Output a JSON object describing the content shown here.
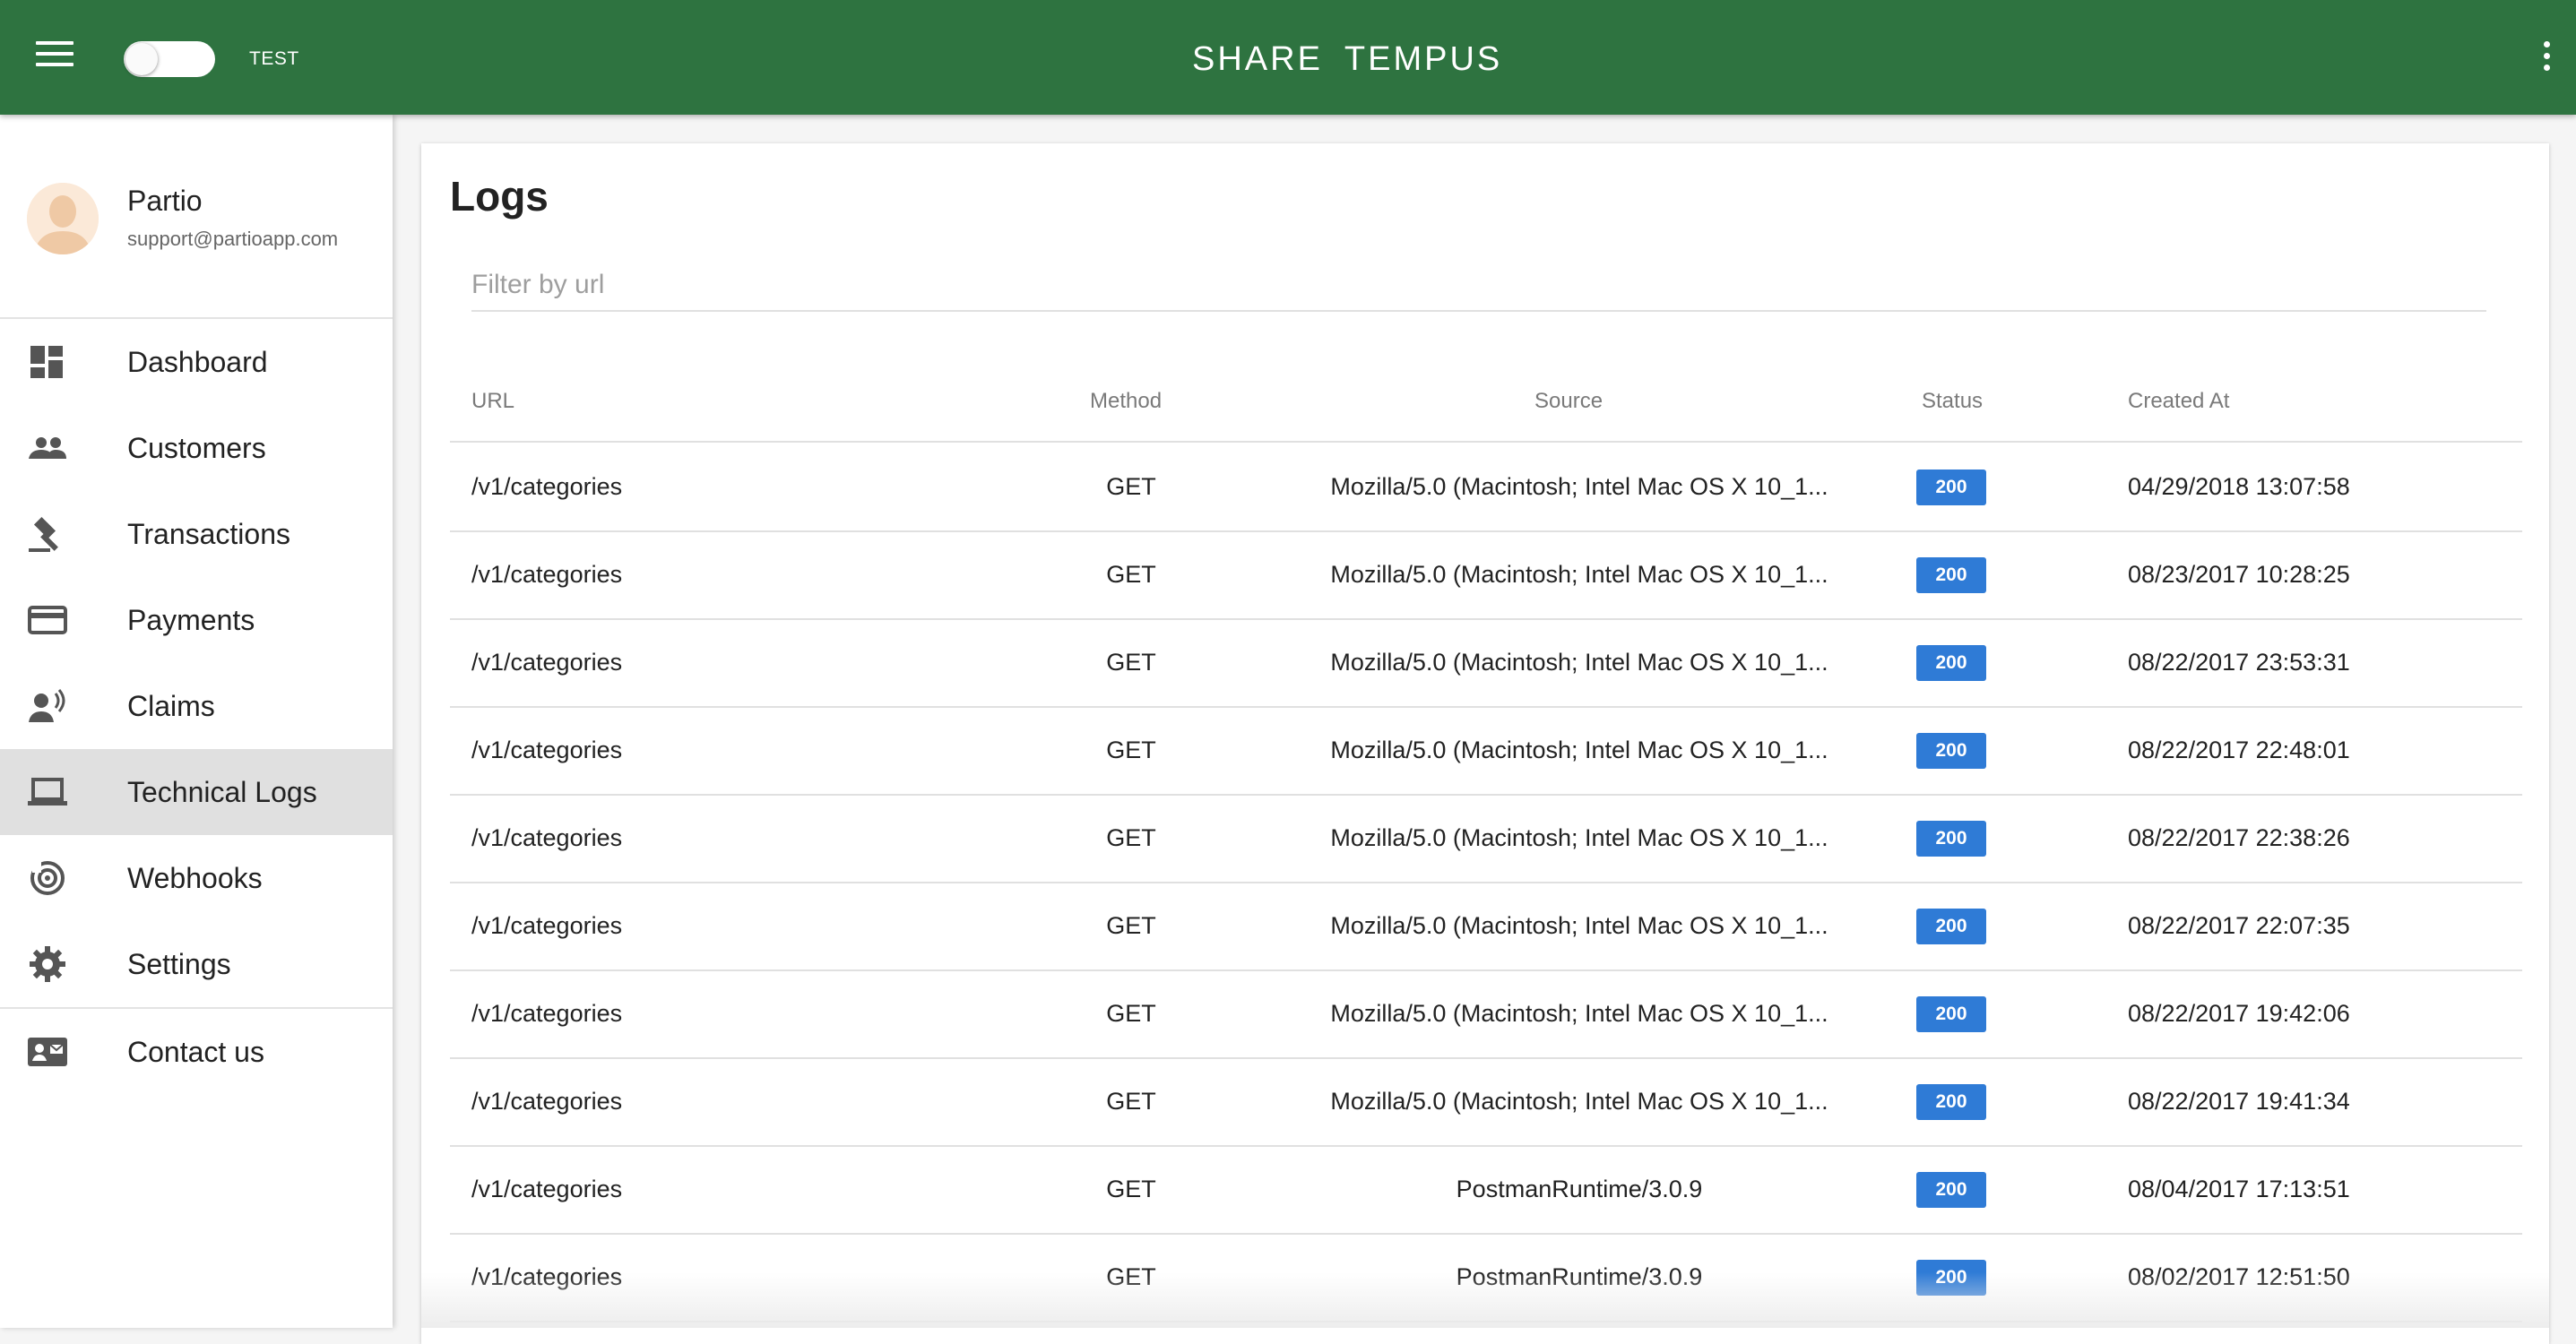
{
  "header": {
    "env_label": "TEST",
    "logo_left": "SHARE",
    "logo_right": "TEMPUS",
    "accent": "#2e7340"
  },
  "profile": {
    "name": "Partio",
    "email": "support@partioapp.com"
  },
  "sidebar": {
    "items": [
      {
        "label": "Dashboard",
        "icon": "dashboard-icon"
      },
      {
        "label": "Customers",
        "icon": "people-icon"
      },
      {
        "label": "Transactions",
        "icon": "gavel-icon"
      },
      {
        "label": "Payments",
        "icon": "credit-card-icon"
      },
      {
        "label": "Claims",
        "icon": "record-voice-icon"
      },
      {
        "label": "Technical Logs",
        "icon": "laptop-icon",
        "active": true
      },
      {
        "label": "Webhooks",
        "icon": "webhook-icon"
      },
      {
        "label": "Settings",
        "icon": "gear-icon"
      },
      {
        "label": "Contact us",
        "icon": "contact-mail-icon"
      }
    ]
  },
  "main": {
    "title": "Logs",
    "filter_placeholder": "Filter by url",
    "columns": {
      "url": "URL",
      "method": "Method",
      "source": "Source",
      "status": "Status",
      "created": "Created At"
    },
    "rows": [
      {
        "url": "/v1/categories",
        "method": "GET",
        "source": "Mozilla/5.0 (Macintosh; Intel Mac OS X 10_1...",
        "status": "200",
        "created": "04/29/2018 13:07:58"
      },
      {
        "url": "/v1/categories",
        "method": "GET",
        "source": "Mozilla/5.0 (Macintosh; Intel Mac OS X 10_1...",
        "status": "200",
        "created": "08/23/2017 10:28:25"
      },
      {
        "url": "/v1/categories",
        "method": "GET",
        "source": "Mozilla/5.0 (Macintosh; Intel Mac OS X 10_1...",
        "status": "200",
        "created": "08/22/2017 23:53:31"
      },
      {
        "url": "/v1/categories",
        "method": "GET",
        "source": "Mozilla/5.0 (Macintosh; Intel Mac OS X 10_1...",
        "status": "200",
        "created": "08/22/2017 22:48:01"
      },
      {
        "url": "/v1/categories",
        "method": "GET",
        "source": "Mozilla/5.0 (Macintosh; Intel Mac OS X 10_1...",
        "status": "200",
        "created": "08/22/2017 22:38:26"
      },
      {
        "url": "/v1/categories",
        "method": "GET",
        "source": "Mozilla/5.0 (Macintosh; Intel Mac OS X 10_1...",
        "status": "200",
        "created": "08/22/2017 22:07:35"
      },
      {
        "url": "/v1/categories",
        "method": "GET",
        "source": "Mozilla/5.0 (Macintosh; Intel Mac OS X 10_1...",
        "status": "200",
        "created": "08/22/2017 19:42:06"
      },
      {
        "url": "/v1/categories",
        "method": "GET",
        "source": "Mozilla/5.0 (Macintosh; Intel Mac OS X 10_1...",
        "status": "200",
        "created": "08/22/2017 19:41:34"
      },
      {
        "url": "/v1/categories",
        "method": "GET",
        "source": "PostmanRuntime/3.0.9",
        "status": "200",
        "created": "08/04/2017 17:13:51"
      },
      {
        "url": "/v1/categories",
        "method": "GET",
        "source": "PostmanRuntime/3.0.9",
        "status": "200",
        "created": "08/02/2017 12:51:50"
      }
    ]
  },
  "colors": {
    "status_badge": "#2f7bd6",
    "active_nav": "#e0e0e0"
  }
}
